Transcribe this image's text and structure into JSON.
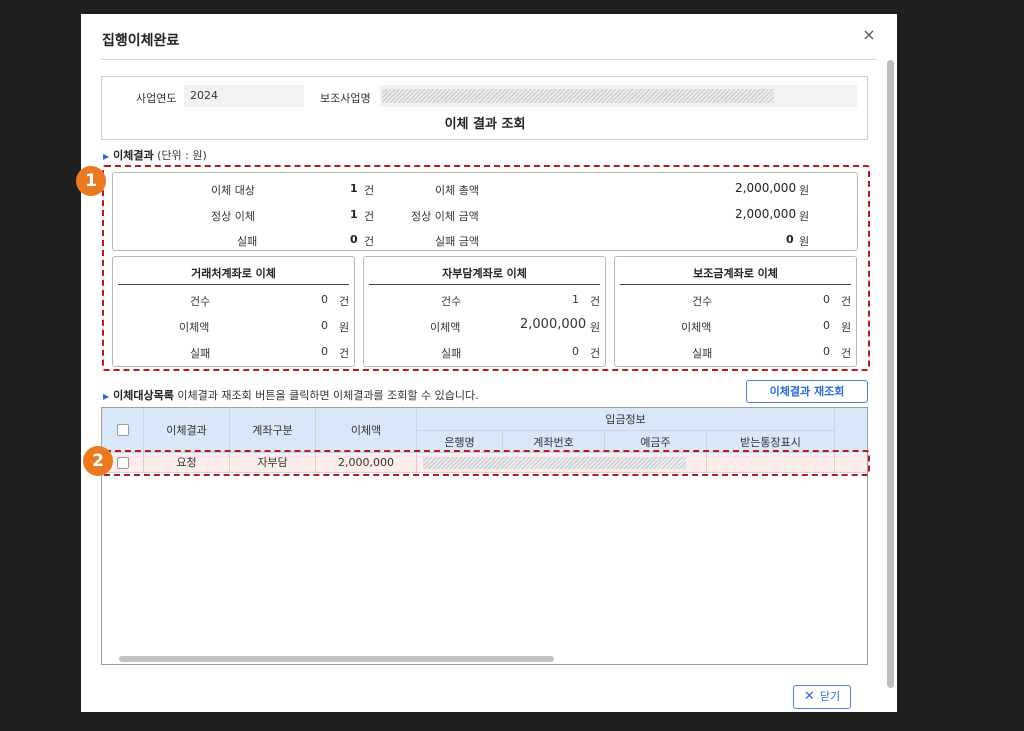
{
  "dialog": {
    "title": "집행이체완료",
    "close_icon": "×"
  },
  "info": {
    "year_label": "사업연도",
    "year_value": "2024",
    "project_label": "보조사업명",
    "action": "이체 결과 조회"
  },
  "result_section": {
    "title": "이체결과",
    "unit": "(단위 : 원)"
  },
  "summary": {
    "target_label": "이체 대상",
    "target_count": "1",
    "count_unit": "건",
    "normal_label": "정상 이체",
    "normal_count": "1",
    "fail_label": "실패",
    "fail_count": "0",
    "total_label": "이체 총액",
    "total_amount": "2,000,000",
    "won_unit": "원",
    "normal_amount_label": "정상 이체 금액",
    "normal_amount": "2,000,000",
    "fail_amount_label": "실패 금액",
    "fail_amount": "0"
  },
  "sub_boxes": [
    {
      "title": "거래처계좌로 이체",
      "count_label": "건수",
      "count": "0",
      "count_unit": "건",
      "amount_label": "이체액",
      "amount": "0",
      "amount_unit": "원",
      "fail_label": "실패",
      "fail": "0",
      "fail_unit": "건"
    },
    {
      "title": "자부담계좌로 이체",
      "count_label": "건수",
      "count": "1",
      "count_unit": "건",
      "amount_label": "이체액",
      "amount": "2,000,000",
      "amount_unit": "원",
      "fail_label": "실패",
      "fail": "0",
      "fail_unit": "건"
    },
    {
      "title": "보조금계좌로 이체",
      "count_label": "건수",
      "count": "0",
      "count_unit": "건",
      "amount_label": "이체액",
      "amount": "0",
      "amount_unit": "원",
      "fail_label": "실패",
      "fail": "0",
      "fail_unit": "건"
    }
  ],
  "badges": [
    "1",
    "2"
  ],
  "list_section": {
    "title": "이체대상목록",
    "hint": "이체결과 재조회 버튼을 클릭하면 이체결과를 조회할 수 있습니다."
  },
  "requery_button": "이체결과 재조회",
  "grid": {
    "headers": {
      "result": "이체결과",
      "account_type": "계좌구분",
      "amount": "이체액",
      "deposit_info": "입금정보",
      "bank": "은행명",
      "account_no": "계좌번호",
      "holder": "예금주",
      "memo": "받는통장표시"
    },
    "rows": [
      {
        "result": "요청",
        "account_type": "자부담",
        "amount": "2,000,000"
      }
    ]
  },
  "close_button": "닫기",
  "colors": {
    "accent": "#2d6cd6",
    "highlight": "#b71c1c",
    "badge": "#ea7a22",
    "grid_header": "#d8e8f8",
    "row_highlight": "#fdecec"
  }
}
